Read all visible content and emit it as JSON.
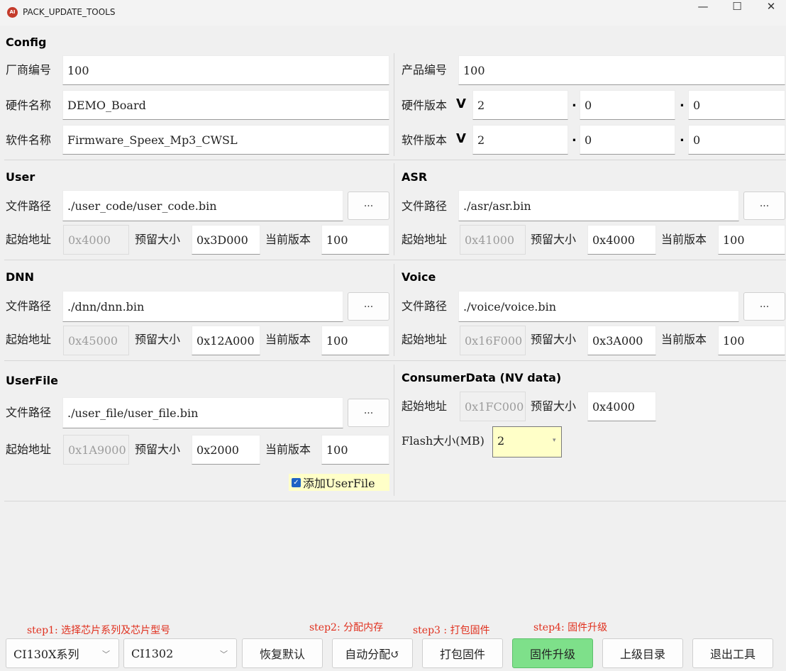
{
  "window": {
    "title": "PACK_UPDATE_TOOLS",
    "icon_text": "AI",
    "min": "—",
    "max": "☐",
    "close": "✕"
  },
  "config": {
    "heading": "Config",
    "vendor_label": "厂商编号",
    "vendor_value": "100",
    "product_label": "产品编号",
    "product_value": "100",
    "hw_name_label": "硬件名称",
    "hw_name_value": "DEMO_Board",
    "hw_ver_label": "硬件版本",
    "v_mark": "V",
    "hw_ver": [
      "2",
      "0",
      "0"
    ],
    "sw_name_label": "软件名称",
    "sw_name_value": "Firmware_Speex_Mp3_CWSL",
    "sw_ver_label": "软件版本",
    "sw_ver": [
      "2",
      "0",
      "0"
    ],
    "dot": "."
  },
  "labels": {
    "path": "文件路径",
    "start": "起始地址",
    "reserve": "预留大小",
    "version": "当前版本",
    "browse": "..."
  },
  "user": {
    "heading": "User",
    "path": "./user_code/user_code.bin",
    "start": "0x4000",
    "reserve": "0x3D000",
    "version": "100"
  },
  "asr": {
    "heading": "ASR",
    "path": "./asr/asr.bin",
    "start": "0x41000",
    "reserve": "0x4000",
    "version": "100"
  },
  "dnn": {
    "heading": "DNN",
    "path": "./dnn/dnn.bin",
    "start": "0x45000",
    "reserve": "0x12A000",
    "version": "100"
  },
  "voice": {
    "heading": "Voice",
    "path": "./voice/voice.bin",
    "start": "0x16F000",
    "reserve": "0x3A000",
    "version": "100"
  },
  "userfile": {
    "heading": "UserFile",
    "path": "./user_file/user_file.bin",
    "start": "0x1A9000",
    "reserve": "0x2000",
    "version": "100",
    "add_label": "添加UserFile",
    "add_checked": true
  },
  "consumer": {
    "heading": "ConsumerData (NV data)",
    "start": "0x1FC000",
    "reserve": "0x4000",
    "flash_label": "Flash大小(MB)",
    "flash_value": "2"
  },
  "steps": {
    "step1": "step1: 选择芯片系列及芯片型号",
    "step2": "step2: 分配内存",
    "step3": "step3 : 打包固件",
    "step4": "step4: 固件升级"
  },
  "toolbar": {
    "series": "CI130X系列",
    "chip": "CI1302",
    "restore": "恢复默认",
    "auto_alloc": "自动分配↺",
    "pack": "打包固件",
    "upgrade": "固件升级",
    "parent_dir": "上级目录",
    "exit": "退出工具"
  },
  "colors": {
    "upgrade_bg": "#7ee08a",
    "step_text": "#e0301e",
    "combo_highlight": "#ffffc8",
    "checkbox": "#1f62c4"
  }
}
